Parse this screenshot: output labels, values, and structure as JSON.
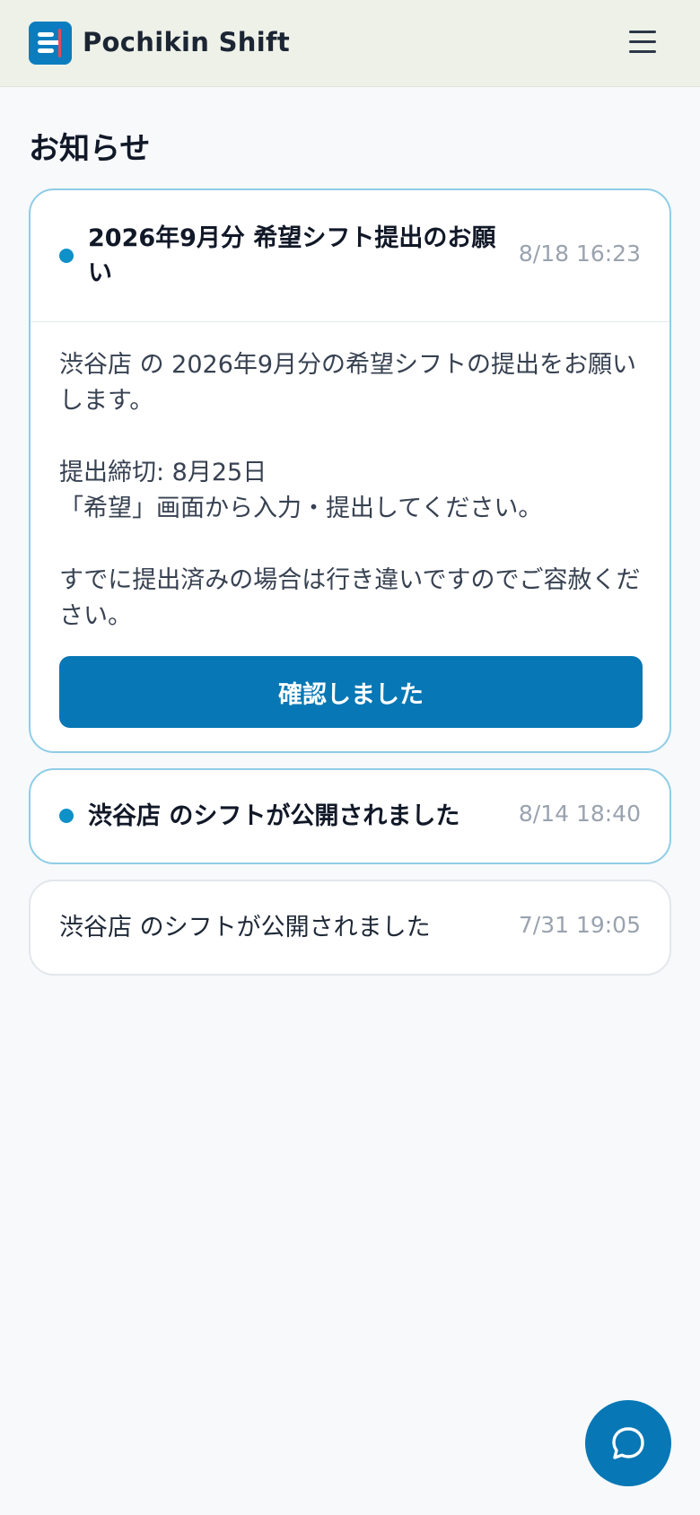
{
  "header": {
    "app_name": "Pochikin Shift",
    "icons": {
      "logo": "pochikin-shift-logo",
      "menu": "hamburger-menu-icon"
    }
  },
  "page": {
    "title": "お知らせ"
  },
  "notifications": [
    {
      "title": "2026年9月分 希望シフト提出のお願い",
      "time": "8/18 16:23",
      "unread": true,
      "expanded": true,
      "body": "渋谷店 の 2026年9月分の希望シフトの提出をお願いします。\n\n提出締切: 8月25日\n「希望」画面から入力・提出してください。\n\nすでに提出済みの場合は行き違いですのでご容赦ください。",
      "action_label": "確認しました"
    },
    {
      "title": "渋谷店 のシフトが公開されました",
      "time": "8/14 18:40",
      "unread": true,
      "expanded": false
    },
    {
      "title": "渋谷店 のシフトが公開されました",
      "time": "7/31 19:05",
      "unread": false,
      "expanded": false
    }
  ],
  "fab": {
    "icon": "chat-bubble-icon"
  },
  "colors": {
    "accent": "#0777b5",
    "unread_dot": "#0e90c8",
    "unread_border": "#8fcde6",
    "header_bg": "#eef1e8"
  }
}
